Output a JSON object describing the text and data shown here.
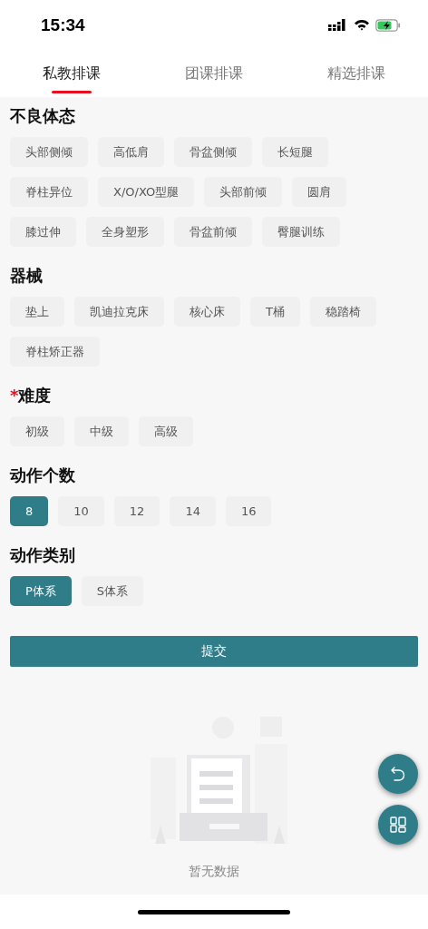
{
  "status_bar": {
    "time": "15:34"
  },
  "tabs": [
    {
      "label": "私教排课",
      "selected": true
    },
    {
      "label": "团课排课",
      "selected": false
    },
    {
      "label": "精选排课",
      "selected": false
    }
  ],
  "sections": [
    {
      "title": "不良体态",
      "options": [
        {
          "label": "头部侧倾",
          "selected": false
        },
        {
          "label": "高低肩",
          "selected": false
        },
        {
          "label": "骨盆侧倾",
          "selected": false
        },
        {
          "label": "长短腿",
          "selected": false
        },
        {
          "label": "脊柱异位",
          "selected": false
        },
        {
          "label": "X/O/XO型腿",
          "selected": false
        },
        {
          "label": "头部前倾",
          "selected": false
        },
        {
          "label": "圆肩",
          "selected": false
        },
        {
          "label": "膝过伸",
          "selected": false
        },
        {
          "label": "全身塑形",
          "selected": false
        },
        {
          "label": "骨盆前倾",
          "selected": false
        },
        {
          "label": "臀腿训练",
          "selected": false
        }
      ]
    },
    {
      "title": "器械",
      "options": [
        {
          "label": "垫上",
          "selected": false
        },
        {
          "label": "凯迪拉克床",
          "selected": false
        },
        {
          "label": "核心床",
          "selected": false
        },
        {
          "label": "T桶",
          "selected": false
        },
        {
          "label": "稳踏椅",
          "selected": false
        },
        {
          "label": "脊柱矫正器",
          "selected": false
        }
      ]
    },
    {
      "title": "难度",
      "required_mark": "*",
      "options": [
        {
          "label": "初级",
          "selected": false
        },
        {
          "label": "中级",
          "selected": false
        },
        {
          "label": "高级",
          "selected": false
        }
      ]
    },
    {
      "title": "动作个数",
      "options": [
        {
          "label": "8",
          "selected": true
        },
        {
          "label": "10",
          "selected": false
        },
        {
          "label": "12",
          "selected": false
        },
        {
          "label": "14",
          "selected": false
        },
        {
          "label": "16",
          "selected": false
        }
      ]
    },
    {
      "title": "动作类别",
      "options": [
        {
          "label": "P体系",
          "selected": true
        },
        {
          "label": "S体系",
          "selected": false
        }
      ]
    }
  ],
  "submit_button": "提交",
  "empty_state": {
    "text": "暂无数据"
  }
}
